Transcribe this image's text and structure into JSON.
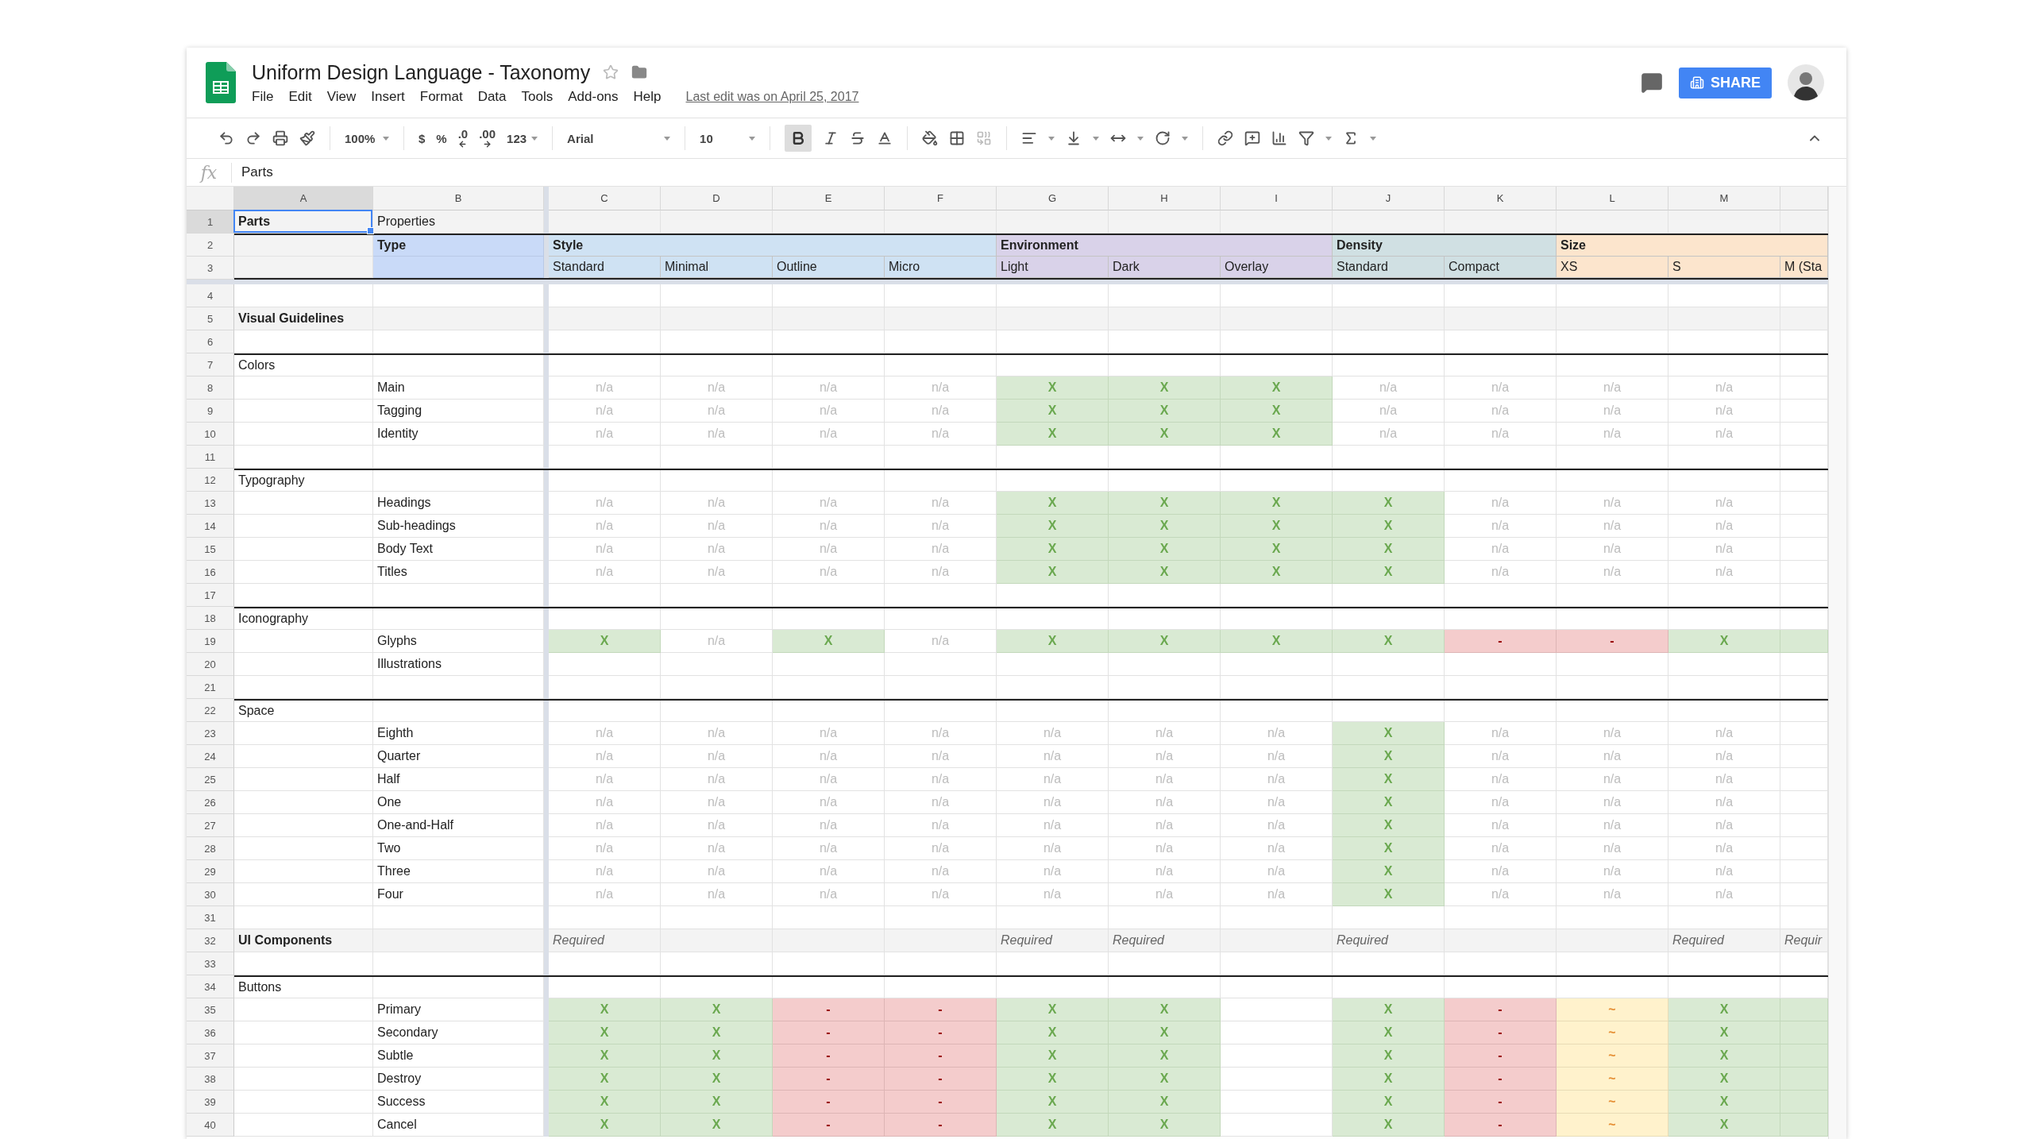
{
  "document": {
    "title": "Uniform Design Language - Taxonomy",
    "menu": [
      "File",
      "Edit",
      "View",
      "Insert",
      "Format",
      "Data",
      "Tools",
      "Add-ons",
      "Help"
    ],
    "last_edit": "Last edit was on April 25, 2017",
    "share": "SHARE"
  },
  "toolbar": {
    "zoom": "100%",
    "currency": "$",
    "percent": "%",
    "decrease_decimals": ".0",
    "increase_decimals": ".00",
    "number_format": "123",
    "font": "Arial",
    "font_size": "10",
    "bold": {
      "selected": true
    }
  },
  "formula_bar": {
    "label": "fx",
    "value": "Parts"
  },
  "columns": [
    {
      "letter": "A",
      "selected": true
    },
    {
      "letter": "B",
      "selected": false
    },
    {
      "letter": "C",
      "selected": false
    },
    {
      "letter": "D",
      "selected": false
    },
    {
      "letter": "E",
      "selected": false
    },
    {
      "letter": "F",
      "selected": false
    },
    {
      "letter": "G",
      "selected": false
    },
    {
      "letter": "H",
      "selected": false
    },
    {
      "letter": "I",
      "selected": false
    },
    {
      "letter": "J",
      "selected": false
    },
    {
      "letter": "K",
      "selected": false
    },
    {
      "letter": "L",
      "selected": false
    },
    {
      "letter": "M",
      "selected": false
    }
  ],
  "groups": [
    {
      "label": "Style",
      "color": "#cfe2f3",
      "columns": [
        "Standard",
        "Minimal",
        "Outline",
        "Micro"
      ]
    },
    {
      "label": "Environment",
      "color": "#d9d2e9",
      "columns": [
        "Light",
        "Dark",
        "Overlay"
      ]
    },
    {
      "label": "Density",
      "color": "#d0e0e3",
      "columns": [
        "Standard",
        "Compact"
      ]
    },
    {
      "label": "Size",
      "color": "#fce5cd",
      "columns": [
        "XS",
        "S",
        "M (Sta"
      ]
    }
  ],
  "rows": [
    {
      "number": "1",
      "kind": "top",
      "selected": true,
      "a": "Parts",
      "b": "Properties"
    },
    {
      "number": "2",
      "kind": "group-heads",
      "selected": false,
      "b": "Type"
    },
    {
      "number": "3",
      "kind": "sub-heads",
      "selected": false
    },
    {
      "number": "4",
      "kind": "blank",
      "selected": false
    },
    {
      "number": "5",
      "kind": "title",
      "selected": false,
      "a": "Visual Guidelines"
    },
    {
      "number": "6",
      "kind": "blank",
      "selected": false
    },
    {
      "number": "7",
      "kind": "group",
      "selected": false,
      "a": "Colors"
    },
    {
      "number": "8",
      "kind": "item",
      "selected": false,
      "b": "Main",
      "cells": [
        {
          "kind": "na",
          "text": "n/a"
        },
        {
          "kind": "na",
          "text": "n/a"
        },
        {
          "kind": "na",
          "text": "n/a"
        },
        {
          "kind": "na",
          "text": "n/a"
        },
        {
          "kind": "yes",
          "text": "X"
        },
        {
          "kind": "yes",
          "text": "X"
        },
        {
          "kind": "yes",
          "text": "X"
        },
        {
          "kind": "na",
          "text": "n/a"
        },
        {
          "kind": "na",
          "text": "n/a"
        },
        {
          "kind": "na",
          "text": "n/a"
        },
        {
          "kind": "na",
          "text": "n/a"
        },
        {
          "kind": "empty"
        }
      ]
    },
    {
      "number": "9",
      "kind": "item",
      "selected": false,
      "b": "Tagging",
      "cells": [
        {
          "kind": "na",
          "text": "n/a"
        },
        {
          "kind": "na",
          "text": "n/a"
        },
        {
          "kind": "na",
          "text": "n/a"
        },
        {
          "kind": "na",
          "text": "n/a"
        },
        {
          "kind": "yes",
          "text": "X"
        },
        {
          "kind": "yes",
          "text": "X"
        },
        {
          "kind": "yes",
          "text": "X"
        },
        {
          "kind": "na",
          "text": "n/a"
        },
        {
          "kind": "na",
          "text": "n/a"
        },
        {
          "kind": "na",
          "text": "n/a"
        },
        {
          "kind": "na",
          "text": "n/a"
        },
        {
          "kind": "empty"
        }
      ]
    },
    {
      "number": "10",
      "kind": "item",
      "selected": false,
      "b": "Identity",
      "cells": [
        {
          "kind": "na",
          "text": "n/a"
        },
        {
          "kind": "na",
          "text": "n/a"
        },
        {
          "kind": "na",
          "text": "n/a"
        },
        {
          "kind": "na",
          "text": "n/a"
        },
        {
          "kind": "yes",
          "text": "X"
        },
        {
          "kind": "yes",
          "text": "X"
        },
        {
          "kind": "yes",
          "text": "X"
        },
        {
          "kind": "na",
          "text": "n/a"
        },
        {
          "kind": "na",
          "text": "n/a"
        },
        {
          "kind": "na",
          "text": "n/a"
        },
        {
          "kind": "na",
          "text": "n/a"
        },
        {
          "kind": "empty"
        }
      ]
    },
    {
      "number": "11",
      "kind": "blank",
      "selected": false
    },
    {
      "number": "12",
      "kind": "group",
      "selected": false,
      "a": "Typography"
    },
    {
      "number": "13",
      "kind": "item",
      "selected": false,
      "b": "Headings",
      "cells": [
        {
          "kind": "na",
          "text": "n/a"
        },
        {
          "kind": "na",
          "text": "n/a"
        },
        {
          "kind": "na",
          "text": "n/a"
        },
        {
          "kind": "na",
          "text": "n/a"
        },
        {
          "kind": "yes",
          "text": "X"
        },
        {
          "kind": "yes",
          "text": "X"
        },
        {
          "kind": "yes",
          "text": "X"
        },
        {
          "kind": "yes",
          "text": "X"
        },
        {
          "kind": "na",
          "text": "n/a"
        },
        {
          "kind": "na",
          "text": "n/a"
        },
        {
          "kind": "na",
          "text": "n/a"
        },
        {
          "kind": "empty"
        }
      ]
    },
    {
      "number": "14",
      "kind": "item",
      "selected": false,
      "b": "Sub-headings",
      "cells": [
        {
          "kind": "na",
          "text": "n/a"
        },
        {
          "kind": "na",
          "text": "n/a"
        },
        {
          "kind": "na",
          "text": "n/a"
        },
        {
          "kind": "na",
          "text": "n/a"
        },
        {
          "kind": "yes",
          "text": "X"
        },
        {
          "kind": "yes",
          "text": "X"
        },
        {
          "kind": "yes",
          "text": "X"
        },
        {
          "kind": "yes",
          "text": "X"
        },
        {
          "kind": "na",
          "text": "n/a"
        },
        {
          "kind": "na",
          "text": "n/a"
        },
        {
          "kind": "na",
          "text": "n/a"
        },
        {
          "kind": "empty"
        }
      ]
    },
    {
      "number": "15",
      "kind": "item",
      "selected": false,
      "b": "Body Text",
      "cells": [
        {
          "kind": "na",
          "text": "n/a"
        },
        {
          "kind": "na",
          "text": "n/a"
        },
        {
          "kind": "na",
          "text": "n/a"
        },
        {
          "kind": "na",
          "text": "n/a"
        },
        {
          "kind": "yes",
          "text": "X"
        },
        {
          "kind": "yes",
          "text": "X"
        },
        {
          "kind": "yes",
          "text": "X"
        },
        {
          "kind": "yes",
          "text": "X"
        },
        {
          "kind": "na",
          "text": "n/a"
        },
        {
          "kind": "na",
          "text": "n/a"
        },
        {
          "kind": "na",
          "text": "n/a"
        },
        {
          "kind": "empty"
        }
      ]
    },
    {
      "number": "16",
      "kind": "item",
      "selected": false,
      "b": "Titles",
      "cells": [
        {
          "kind": "na",
          "text": "n/a"
        },
        {
          "kind": "na",
          "text": "n/a"
        },
        {
          "kind": "na",
          "text": "n/a"
        },
        {
          "kind": "na",
          "text": "n/a"
        },
        {
          "kind": "yes",
          "text": "X"
        },
        {
          "kind": "yes",
          "text": "X"
        },
        {
          "kind": "yes",
          "text": "X"
        },
        {
          "kind": "yes",
          "text": "X"
        },
        {
          "kind": "na",
          "text": "n/a"
        },
        {
          "kind": "na",
          "text": "n/a"
        },
        {
          "kind": "na",
          "text": "n/a"
        },
        {
          "kind": "empty"
        }
      ]
    },
    {
      "number": "17",
      "kind": "blank",
      "selected": false
    },
    {
      "number": "18",
      "kind": "group",
      "selected": false,
      "a": "Iconography"
    },
    {
      "number": "19",
      "kind": "item",
      "selected": false,
      "b": "Glyphs",
      "cells": [
        {
          "kind": "yes",
          "text": "X"
        },
        {
          "kind": "na",
          "text": "n/a"
        },
        {
          "kind": "yes",
          "text": "X"
        },
        {
          "kind": "na",
          "text": "n/a"
        },
        {
          "kind": "yes",
          "text": "X"
        },
        {
          "kind": "yes",
          "text": "X"
        },
        {
          "kind": "yes",
          "text": "X"
        },
        {
          "kind": "yes",
          "text": "X"
        },
        {
          "kind": "no",
          "text": "-"
        },
        {
          "kind": "no",
          "text": "-"
        },
        {
          "kind": "yes",
          "text": "X"
        },
        {
          "kind": "yes"
        }
      ]
    },
    {
      "number": "20",
      "kind": "item",
      "selected": false,
      "b": "Illustrations"
    },
    {
      "number": "21",
      "kind": "blank",
      "selected": false
    },
    {
      "number": "22",
      "kind": "group",
      "selected": false,
      "a": "Space"
    },
    {
      "number": "23",
      "kind": "item",
      "selected": false,
      "b": "Eighth",
      "cells": [
        {
          "kind": "na",
          "text": "n/a"
        },
        {
          "kind": "na",
          "text": "n/a"
        },
        {
          "kind": "na",
          "text": "n/a"
        },
        {
          "kind": "na",
          "text": "n/a"
        },
        {
          "kind": "na",
          "text": "n/a"
        },
        {
          "kind": "na",
          "text": "n/a"
        },
        {
          "kind": "na",
          "text": "n/a"
        },
        {
          "kind": "yes",
          "text": "X"
        },
        {
          "kind": "na",
          "text": "n/a"
        },
        {
          "kind": "na",
          "text": "n/a"
        },
        {
          "kind": "na",
          "text": "n/a"
        },
        {
          "kind": "empty"
        }
      ]
    },
    {
      "number": "24",
      "kind": "item",
      "selected": false,
      "b": "Quarter",
      "cells": [
        {
          "kind": "na",
          "text": "n/a"
        },
        {
          "kind": "na",
          "text": "n/a"
        },
        {
          "kind": "na",
          "text": "n/a"
        },
        {
          "kind": "na",
          "text": "n/a"
        },
        {
          "kind": "na",
          "text": "n/a"
        },
        {
          "kind": "na",
          "text": "n/a"
        },
        {
          "kind": "na",
          "text": "n/a"
        },
        {
          "kind": "yes",
          "text": "X"
        },
        {
          "kind": "na",
          "text": "n/a"
        },
        {
          "kind": "na",
          "text": "n/a"
        },
        {
          "kind": "na",
          "text": "n/a"
        },
        {
          "kind": "empty"
        }
      ]
    },
    {
      "number": "25",
      "kind": "item",
      "selected": false,
      "b": "Half",
      "cells": [
        {
          "kind": "na",
          "text": "n/a"
        },
        {
          "kind": "na",
          "text": "n/a"
        },
        {
          "kind": "na",
          "text": "n/a"
        },
        {
          "kind": "na",
          "text": "n/a"
        },
        {
          "kind": "na",
          "text": "n/a"
        },
        {
          "kind": "na",
          "text": "n/a"
        },
        {
          "kind": "na",
          "text": "n/a"
        },
        {
          "kind": "yes",
          "text": "X"
        },
        {
          "kind": "na",
          "text": "n/a"
        },
        {
          "kind": "na",
          "text": "n/a"
        },
        {
          "kind": "na",
          "text": "n/a"
        },
        {
          "kind": "empty"
        }
      ]
    },
    {
      "number": "26",
      "kind": "item",
      "selected": false,
      "b": "One",
      "cells": [
        {
          "kind": "na",
          "text": "n/a"
        },
        {
          "kind": "na",
          "text": "n/a"
        },
        {
          "kind": "na",
          "text": "n/a"
        },
        {
          "kind": "na",
          "text": "n/a"
        },
        {
          "kind": "na",
          "text": "n/a"
        },
        {
          "kind": "na",
          "text": "n/a"
        },
        {
          "kind": "na",
          "text": "n/a"
        },
        {
          "kind": "yes",
          "text": "X"
        },
        {
          "kind": "na",
          "text": "n/a"
        },
        {
          "kind": "na",
          "text": "n/a"
        },
        {
          "kind": "na",
          "text": "n/a"
        },
        {
          "kind": "empty"
        }
      ]
    },
    {
      "number": "27",
      "kind": "item",
      "selected": false,
      "b": "One-and-Half",
      "cells": [
        {
          "kind": "na",
          "text": "n/a"
        },
        {
          "kind": "na",
          "text": "n/a"
        },
        {
          "kind": "na",
          "text": "n/a"
        },
        {
          "kind": "na",
          "text": "n/a"
        },
        {
          "kind": "na",
          "text": "n/a"
        },
        {
          "kind": "na",
          "text": "n/a"
        },
        {
          "kind": "na",
          "text": "n/a"
        },
        {
          "kind": "yes",
          "text": "X"
        },
        {
          "kind": "na",
          "text": "n/a"
        },
        {
          "kind": "na",
          "text": "n/a"
        },
        {
          "kind": "na",
          "text": "n/a"
        },
        {
          "kind": "empty"
        }
      ]
    },
    {
      "number": "28",
      "kind": "item",
      "selected": false,
      "b": "Two",
      "cells": [
        {
          "kind": "na",
          "text": "n/a"
        },
        {
          "kind": "na",
          "text": "n/a"
        },
        {
          "kind": "na",
          "text": "n/a"
        },
        {
          "kind": "na",
          "text": "n/a"
        },
        {
          "kind": "na",
          "text": "n/a"
        },
        {
          "kind": "na",
          "text": "n/a"
        },
        {
          "kind": "na",
          "text": "n/a"
        },
        {
          "kind": "yes",
          "text": "X"
        },
        {
          "kind": "na",
          "text": "n/a"
        },
        {
          "kind": "na",
          "text": "n/a"
        },
        {
          "kind": "na",
          "text": "n/a"
        },
        {
          "kind": "empty"
        }
      ]
    },
    {
      "number": "29",
      "kind": "item",
      "selected": false,
      "b": "Three",
      "cells": [
        {
          "kind": "na",
          "text": "n/a"
        },
        {
          "kind": "na",
          "text": "n/a"
        },
        {
          "kind": "na",
          "text": "n/a"
        },
        {
          "kind": "na",
          "text": "n/a"
        },
        {
          "kind": "na",
          "text": "n/a"
        },
        {
          "kind": "na",
          "text": "n/a"
        },
        {
          "kind": "na",
          "text": "n/a"
        },
        {
          "kind": "yes",
          "text": "X"
        },
        {
          "kind": "na",
          "text": "n/a"
        },
        {
          "kind": "na",
          "text": "n/a"
        },
        {
          "kind": "na",
          "text": "n/a"
        },
        {
          "kind": "empty"
        }
      ]
    },
    {
      "number": "30",
      "kind": "item",
      "selected": false,
      "b": "Four",
      "cells": [
        {
          "kind": "na",
          "text": "n/a"
        },
        {
          "kind": "na",
          "text": "n/a"
        },
        {
          "kind": "na",
          "text": "n/a"
        },
        {
          "kind": "na",
          "text": "n/a"
        },
        {
          "kind": "na",
          "text": "n/a"
        },
        {
          "kind": "na",
          "text": "n/a"
        },
        {
          "kind": "na",
          "text": "n/a"
        },
        {
          "kind": "yes",
          "text": "X"
        },
        {
          "kind": "na",
          "text": "n/a"
        },
        {
          "kind": "na",
          "text": "n/a"
        },
        {
          "kind": "na",
          "text": "n/a"
        },
        {
          "kind": "empty"
        }
      ]
    },
    {
      "number": "31",
      "kind": "blank",
      "selected": false
    },
    {
      "number": "32",
      "kind": "title",
      "selected": false,
      "a": "UI Components",
      "cells": [
        {
          "kind": "note",
          "text": "Required"
        },
        {
          "kind": "empty"
        },
        {
          "kind": "empty"
        },
        {
          "kind": "empty"
        },
        {
          "kind": "note",
          "text": "Required"
        },
        {
          "kind": "note",
          "text": "Required"
        },
        {
          "kind": "empty"
        },
        {
          "kind": "note",
          "text": "Required"
        },
        {
          "kind": "empty"
        },
        {
          "kind": "empty"
        },
        {
          "kind": "note",
          "text": "Required"
        },
        {
          "kind": "note",
          "text": "Requir"
        }
      ]
    },
    {
      "number": "33",
      "kind": "blank",
      "selected": false
    },
    {
      "number": "34",
      "kind": "group",
      "selected": false,
      "a": "Buttons"
    },
    {
      "number": "35",
      "kind": "item",
      "selected": false,
      "b": "Primary",
      "cells": [
        {
          "kind": "yes",
          "text": "X"
        },
        {
          "kind": "yes",
          "text": "X"
        },
        {
          "kind": "no",
          "text": "-"
        },
        {
          "kind": "no",
          "text": "-"
        },
        {
          "kind": "yes",
          "text": "X"
        },
        {
          "kind": "yes",
          "text": "X"
        },
        {
          "kind": "empty"
        },
        {
          "kind": "yes",
          "text": "X"
        },
        {
          "kind": "no",
          "text": "-"
        },
        {
          "kind": "maybe",
          "text": "~"
        },
        {
          "kind": "yes",
          "text": "X"
        },
        {
          "kind": "yes"
        }
      ]
    },
    {
      "number": "36",
      "kind": "item",
      "selected": false,
      "b": "Secondary",
      "cells": [
        {
          "kind": "yes",
          "text": "X"
        },
        {
          "kind": "yes",
          "text": "X"
        },
        {
          "kind": "no",
          "text": "-"
        },
        {
          "kind": "no",
          "text": "-"
        },
        {
          "kind": "yes",
          "text": "X"
        },
        {
          "kind": "yes",
          "text": "X"
        },
        {
          "kind": "empty"
        },
        {
          "kind": "yes",
          "text": "X"
        },
        {
          "kind": "no",
          "text": "-"
        },
        {
          "kind": "maybe",
          "text": "~"
        },
        {
          "kind": "yes",
          "text": "X"
        },
        {
          "kind": "yes"
        }
      ]
    },
    {
      "number": "37",
      "kind": "item",
      "selected": false,
      "b": "Subtle",
      "cells": [
        {
          "kind": "yes",
          "text": "X"
        },
        {
          "kind": "yes",
          "text": "X"
        },
        {
          "kind": "no",
          "text": "-"
        },
        {
          "kind": "no",
          "text": "-"
        },
        {
          "kind": "yes",
          "text": "X"
        },
        {
          "kind": "yes",
          "text": "X"
        },
        {
          "kind": "empty"
        },
        {
          "kind": "yes",
          "text": "X"
        },
        {
          "kind": "no",
          "text": "-"
        },
        {
          "kind": "maybe",
          "text": "~"
        },
        {
          "kind": "yes",
          "text": "X"
        },
        {
          "kind": "yes"
        }
      ]
    },
    {
      "number": "38",
      "kind": "item",
      "selected": false,
      "b": "Destroy",
      "cells": [
        {
          "kind": "yes",
          "text": "X"
        },
        {
          "kind": "yes",
          "text": "X"
        },
        {
          "kind": "no",
          "text": "-"
        },
        {
          "kind": "no",
          "text": "-"
        },
        {
          "kind": "yes",
          "text": "X"
        },
        {
          "kind": "yes",
          "text": "X"
        },
        {
          "kind": "empty"
        },
        {
          "kind": "yes",
          "text": "X"
        },
        {
          "kind": "no",
          "text": "-"
        },
        {
          "kind": "maybe",
          "text": "~"
        },
        {
          "kind": "yes",
          "text": "X"
        },
        {
          "kind": "yes"
        }
      ]
    },
    {
      "number": "39",
      "kind": "item",
      "selected": false,
      "b": "Success",
      "cells": [
        {
          "kind": "yes",
          "text": "X"
        },
        {
          "kind": "yes",
          "text": "X"
        },
        {
          "kind": "no",
          "text": "-"
        },
        {
          "kind": "no",
          "text": "-"
        },
        {
          "kind": "yes",
          "text": "X"
        },
        {
          "kind": "yes",
          "text": "X"
        },
        {
          "kind": "empty"
        },
        {
          "kind": "yes",
          "text": "X"
        },
        {
          "kind": "no",
          "text": "-"
        },
        {
          "kind": "maybe",
          "text": "~"
        },
        {
          "kind": "yes",
          "text": "X"
        },
        {
          "kind": "yes"
        }
      ]
    },
    {
      "number": "40",
      "kind": "item",
      "selected": false,
      "b": "Cancel",
      "cells": [
        {
          "kind": "yes",
          "text": "X"
        },
        {
          "kind": "yes",
          "text": "X"
        },
        {
          "kind": "no",
          "text": "-"
        },
        {
          "kind": "no",
          "text": "-"
        },
        {
          "kind": "yes",
          "text": "X"
        },
        {
          "kind": "yes",
          "text": "X"
        },
        {
          "kind": "empty"
        },
        {
          "kind": "yes",
          "text": "X"
        },
        {
          "kind": "no",
          "text": "-"
        },
        {
          "kind": "maybe",
          "text": "~"
        },
        {
          "kind": "yes",
          "text": "X"
        },
        {
          "kind": "yes"
        }
      ]
    }
  ]
}
